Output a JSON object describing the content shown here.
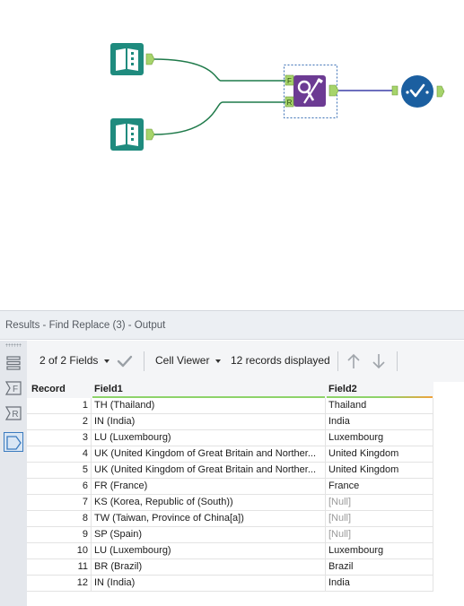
{
  "colors": {
    "input_tool": "#1f8b7e",
    "find_replace_tool": "#6c3b93",
    "browse_tool": "#1b5fa0",
    "connection_green": "#1f7a4a",
    "connection_blue": "#3c3fa8",
    "anchor_green": "#a6d46b",
    "null_text": "#9a9a9a"
  },
  "workflow": {
    "tools": [
      {
        "name": "input-data-tool-1",
        "icon": "book-icon"
      },
      {
        "name": "input-data-tool-2",
        "icon": "book-icon"
      },
      {
        "name": "find-replace-tool",
        "icon": "find-replace-icon",
        "anchors": [
          "F",
          "R"
        ]
      },
      {
        "name": "browse-tool",
        "icon": "browse-check-icon"
      }
    ]
  },
  "results": {
    "title": "Results - Find Replace (3) - Output",
    "side_rail": {
      "icons": [
        "table-view-icon",
        "input-f-anchor-icon",
        "input-r-anchor-icon",
        "output-anchor-icon"
      ],
      "active": "output-anchor-icon"
    },
    "toolbar": {
      "fields_label": "2 of 2 Fields",
      "viewer_label": "Cell Viewer",
      "records_label": "12 records displayed"
    },
    "table": {
      "columns": [
        "Record",
        "Field1",
        "Field2"
      ],
      "rows": [
        {
          "record": "1",
          "field1": "TH (Thailand)",
          "field2": "Thailand",
          "null": false
        },
        {
          "record": "2",
          "field1": "IN (India)",
          "field2": "India",
          "null": false
        },
        {
          "record": "3",
          "field1": "LU (Luxembourg)",
          "field2": "Luxembourg",
          "null": false
        },
        {
          "record": "4",
          "field1": "UK (United Kingdom of Great Britain and Norther...",
          "field2": "United Kingdom",
          "null": false
        },
        {
          "record": "5",
          "field1": "UK (United Kingdom of Great Britain and Norther...",
          "field2": "United Kingdom",
          "null": false
        },
        {
          "record": "6",
          "field1": "FR (France)",
          "field2": "France",
          "null": false
        },
        {
          "record": "7",
          "field1": "KS (Korea, Republic of (South))",
          "field2": "[Null]",
          "null": true
        },
        {
          "record": "8",
          "field1": "TW (Taiwan, Province of China[a])",
          "field2": "[Null]",
          "null": true
        },
        {
          "record": "9",
          "field1": "SP (Spain)",
          "field2": "[Null]",
          "null": true
        },
        {
          "record": "10",
          "field1": "LU (Luxembourg)",
          "field2": "Luxembourg",
          "null": false
        },
        {
          "record": "11",
          "field1": "BR (Brazil)",
          "field2": "Brazil",
          "null": false
        },
        {
          "record": "12",
          "field1": "IN (India)",
          "field2": "India",
          "null": false
        }
      ]
    }
  }
}
